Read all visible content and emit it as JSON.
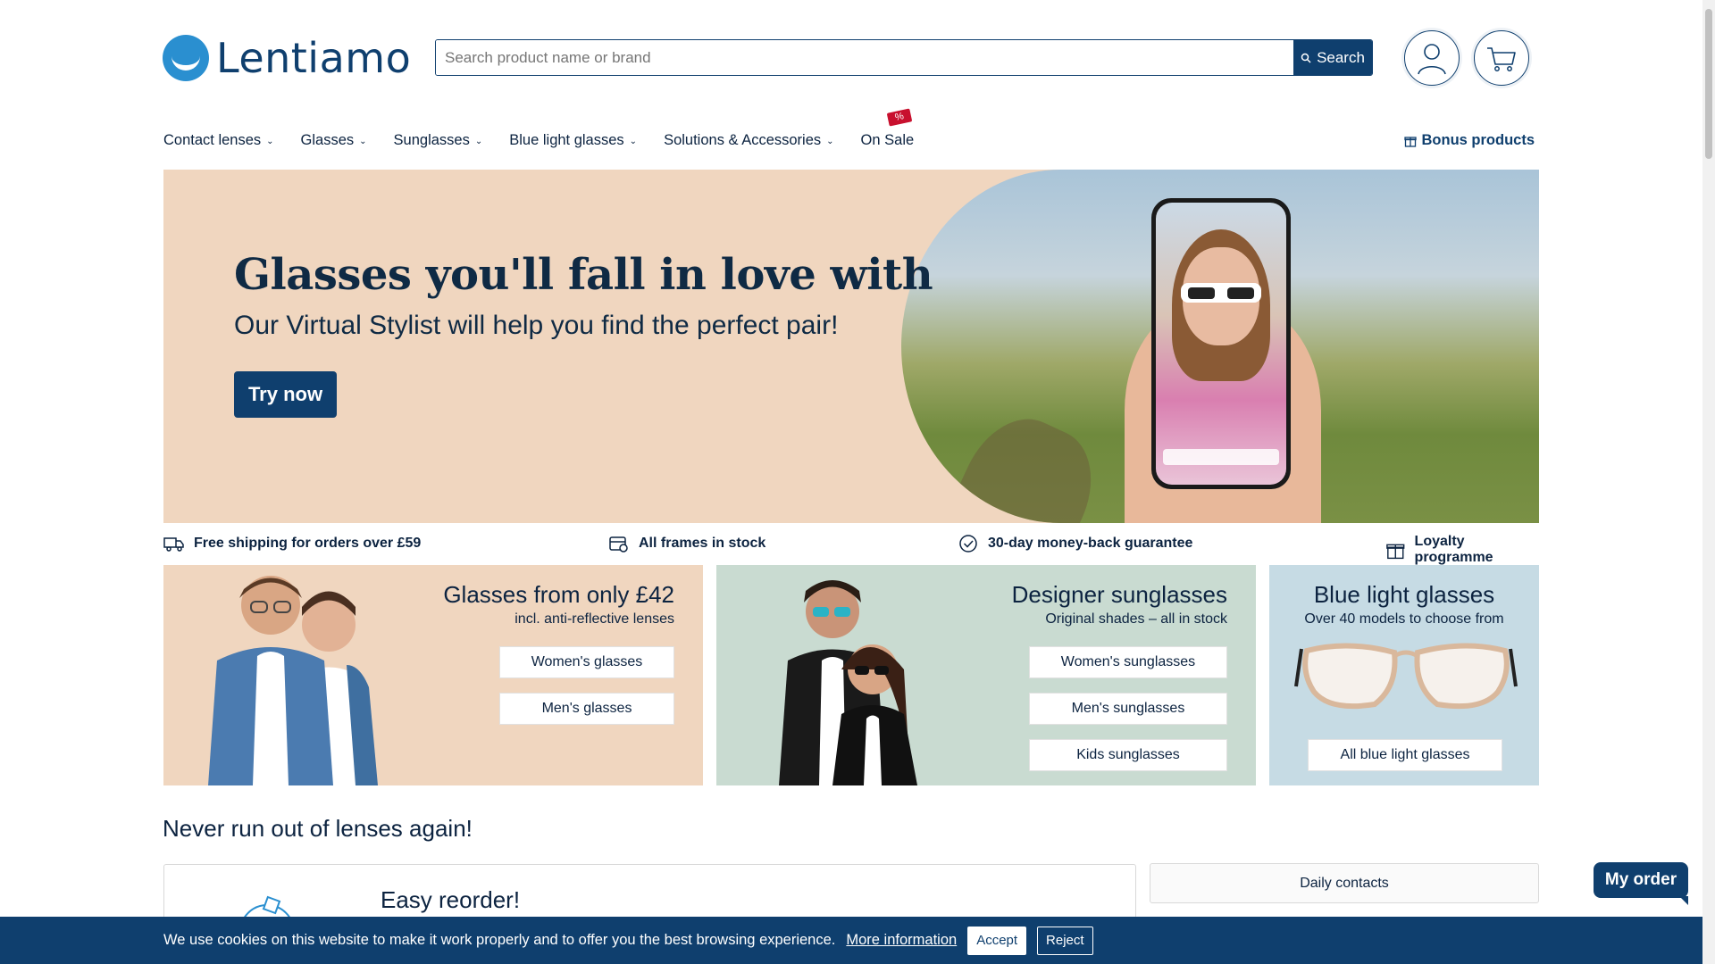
{
  "header": {
    "logo_text": "Lentiamo",
    "search_placeholder": "Search product name or brand",
    "search_button": "Search"
  },
  "nav": {
    "items": [
      {
        "label": "Contact lenses"
      },
      {
        "label": "Glasses"
      },
      {
        "label": "Sunglasses"
      },
      {
        "label": "Blue light glasses"
      },
      {
        "label": "Solutions & Accessories"
      },
      {
        "label": "On Sale"
      }
    ],
    "sale_badge": "%",
    "bonus_label": "Bonus products"
  },
  "hero": {
    "title": "Glasses you'll fall in love with",
    "subtitle": "Our Virtual Stylist will help you find the perfect pair!",
    "cta": "Try now"
  },
  "usps": [
    {
      "label": "Free shipping for orders over £59",
      "icon": "truck-icon"
    },
    {
      "label": "All frames in stock",
      "icon": "box-icon"
    },
    {
      "label": "30-day money-back guarantee",
      "icon": "badge-check-icon"
    },
    {
      "label": "Loyalty programme",
      "icon": "gift-icon"
    }
  ],
  "cards": {
    "glasses": {
      "title": "Glasses from only £42",
      "subtitle": "incl. anti-reflective lenses",
      "buttons": [
        "Women's glasses",
        "Men's glasses"
      ]
    },
    "sunglasses": {
      "title": "Designer sunglasses",
      "subtitle": "Original shades – all in stock",
      "buttons": [
        "Women's sunglasses",
        "Men's sunglasses",
        "Kids sunglasses"
      ]
    },
    "bluelight": {
      "title": "Blue light glasses",
      "subtitle": "Over 40 models to choose from",
      "buttons": [
        "All blue light glasses"
      ]
    }
  },
  "lenses": {
    "section_title": "Never run out of lenses again!",
    "reorder_title": "Easy reorder!",
    "daily_button": "Daily contacts"
  },
  "my_order": "My order",
  "cookie": {
    "text": "We use cookies on this website to make it work properly and to offer you the best browsing experience.",
    "more_info": "More information",
    "accept": "Accept",
    "reject": "Reject"
  },
  "colors": {
    "brand_navy": "#0f3f6e",
    "brand_blue": "#2a8fd0",
    "peach": "#f0d6bf",
    "sage": "#c9dbd1",
    "light_blue": "#c6dbe4",
    "sale_red": "#c8102e"
  }
}
